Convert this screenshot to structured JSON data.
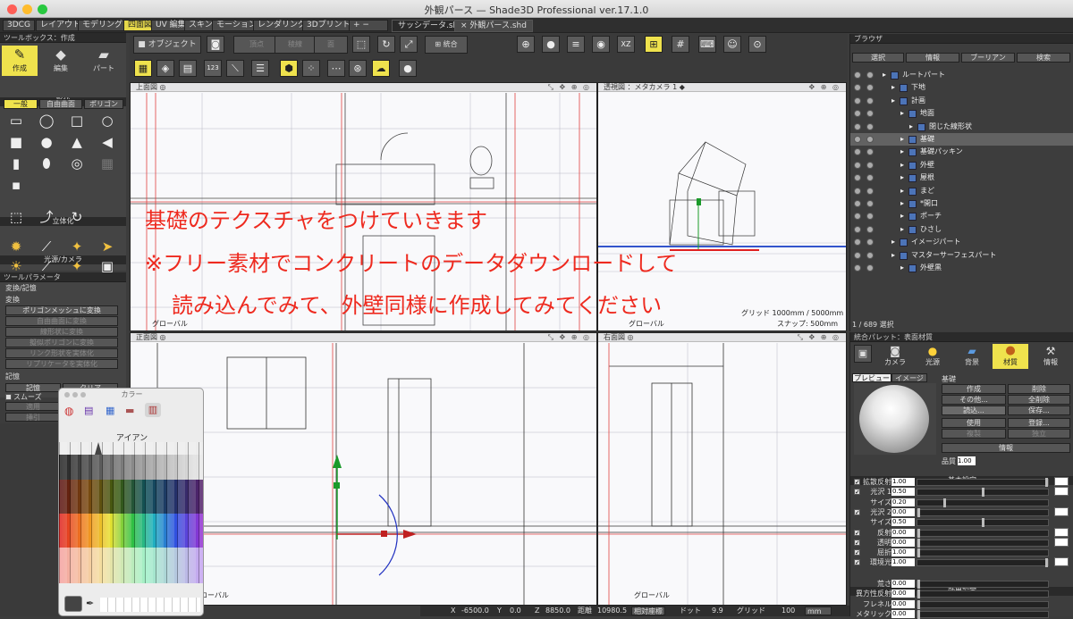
{
  "window": {
    "title": "外観パース — Shade3D Professional ver.17.1.0"
  },
  "mode_tabs": [
    "3DCG",
    "レイアウト",
    "モデリング",
    "四面図",
    "UV 編集",
    "スキン",
    "モーション",
    "レンダリング",
    "3Dプリント",
    "+  −"
  ],
  "doc_tabs": [
    "サッシデータ.shd",
    "× 外観パース.shd"
  ],
  "toolbox": {
    "header": "ツールボックス：作成",
    "tabs": [
      "作成",
      "編集",
      "パート"
    ],
    "shape_section": "形状",
    "shape_tabs": [
      "一般",
      "自由曲面",
      "ポリゴン"
    ],
    "solid_section": "立体化",
    "light_section": "光源/カメラ"
  },
  "tool_params": {
    "header": "ツールパラメータ",
    "title": "変換/記憶",
    "convert_section": "変換",
    "buttons": [
      "ポリゴンメッシュに変換",
      "自由曲面に変換",
      "線形状に変換",
      "擬似ポリゴンに変換",
      "リンク形状を実体化",
      "リプリケータを実体化"
    ],
    "memory_section": "記憶",
    "memory_buttons": [
      "記憶",
      "クリア"
    ],
    "smooth": "スムーズ",
    "apply": "適用",
    "undo": "挿引"
  },
  "color_picker": {
    "title": "カラー",
    "swatch_name": "アイアン"
  },
  "toolbar": {
    "object_label": "オブジェクト",
    "vertex": "頂点",
    "edge": "稜線",
    "face": "面",
    "merge": "統合"
  },
  "viewports": {
    "top": "上面図",
    "persp": "透視図 ：メタカメラ 1",
    "front": "正面図",
    "right": "右面図",
    "global": "グローバル",
    "grid_info": "グリッド 1000mm / 5000mm",
    "snap": "スナップ: 500mm"
  },
  "overlay": {
    "line1": "基礎のテクスチャをつけていきます",
    "line2": "※フリー素材でコンクリートのデータダウンロードして",
    "line3": "読み込んでみて、外壁同様に作成してみてください"
  },
  "browser": {
    "header": "ブラウザ",
    "tabs": [
      "選択",
      "情報",
      "ブーリアン",
      "検索"
    ],
    "footer": "1 / 689 選択",
    "items": [
      {
        "label": "ルートパート",
        "indent": 0
      },
      {
        "label": "下地",
        "indent": 1
      },
      {
        "label": "計画",
        "indent": 1
      },
      {
        "label": "地面",
        "indent": 2
      },
      {
        "label": "閉じた線形状",
        "indent": 3
      },
      {
        "label": "基礎",
        "indent": 2
      },
      {
        "label": "基礎パッキン",
        "indent": 2
      },
      {
        "label": "外壁",
        "indent": 2
      },
      {
        "label": "屋根",
        "indent": 2
      },
      {
        "label": "まど",
        "indent": 2
      },
      {
        "label": "*開口",
        "indent": 2
      },
      {
        "label": "ポーチ",
        "indent": 2
      },
      {
        "label": "ひさし",
        "indent": 2
      },
      {
        "label": "イメージパート",
        "indent": 1
      },
      {
        "label": "マスターサーフェスパート",
        "indent": 1
      },
      {
        "label": "外壁黒",
        "indent": 2
      }
    ]
  },
  "palette": {
    "header": "統合パレット：表面材質",
    "tabs": [
      "カメラ",
      "光源",
      "背景",
      "材質",
      "情報"
    ],
    "preview_tabs": [
      "プレビュー",
      "イメージ"
    ],
    "material_name": "基礎",
    "buttons": [
      "作成",
      "削除",
      "その他...",
      "全削除",
      "読込...",
      "保存...",
      "使用",
      "登録...",
      "複製",
      "独立",
      "情報"
    ],
    "quality_label": "品質",
    "quality": "1.00",
    "basic_section": "基本設定",
    "effect_section": "効果設定",
    "params": [
      {
        "label": "拡散反射",
        "value": "1.00",
        "pos": 0.99,
        "check": true,
        "swatch": true
      },
      {
        "label": "光沢 1",
        "value": "0.50",
        "pos": 0.5,
        "check": true,
        "swatch": true
      },
      {
        "label": "サイズ",
        "value": "0.20",
        "pos": 0.2,
        "check": false,
        "swatch": false
      },
      {
        "label": "光沢 2",
        "value": "0.00",
        "pos": 0.0,
        "check": true,
        "swatch": true
      },
      {
        "label": "サイズ",
        "value": "0.50",
        "pos": 0.5,
        "check": false,
        "swatch": false
      },
      {
        "label": "反射",
        "value": "0.00",
        "pos": 0.0,
        "check": true,
        "swatch": true
      },
      {
        "label": "透明",
        "value": "0.00",
        "pos": 0.0,
        "check": true,
        "swatch": true
      },
      {
        "label": "屈折",
        "value": "1.00",
        "pos": 0.0,
        "check": true,
        "swatch": false
      },
      {
        "label": "環境光",
        "value": "1.00",
        "pos": 0.99,
        "check": true,
        "swatch": true
      }
    ],
    "effects": [
      {
        "label": "荒さ",
        "value": "0.00",
        "pos": 0.0
      },
      {
        "label": "異方性反射",
        "value": "0.00",
        "pos": 0.0
      },
      {
        "label": "フレネル",
        "value": "0.00",
        "pos": 0.0
      },
      {
        "label": "メタリック",
        "value": "0.00",
        "pos": 0.0
      }
    ]
  },
  "status": {
    "x_label": "X",
    "x": "-6500.0",
    "y_label": "Y",
    "y": "0.0",
    "z_label": "Z",
    "z": "8850.0",
    "dist_label": "距離",
    "dist": "10980.5",
    "coord": "相対座標",
    "dot_label": "ドット",
    "dot": "9.9",
    "grid_label": "グリッド",
    "grid": "100",
    "unit": "mm"
  },
  "colors": {
    "accent": "#efe24d",
    "overlay_text": "#ee2a1f"
  }
}
